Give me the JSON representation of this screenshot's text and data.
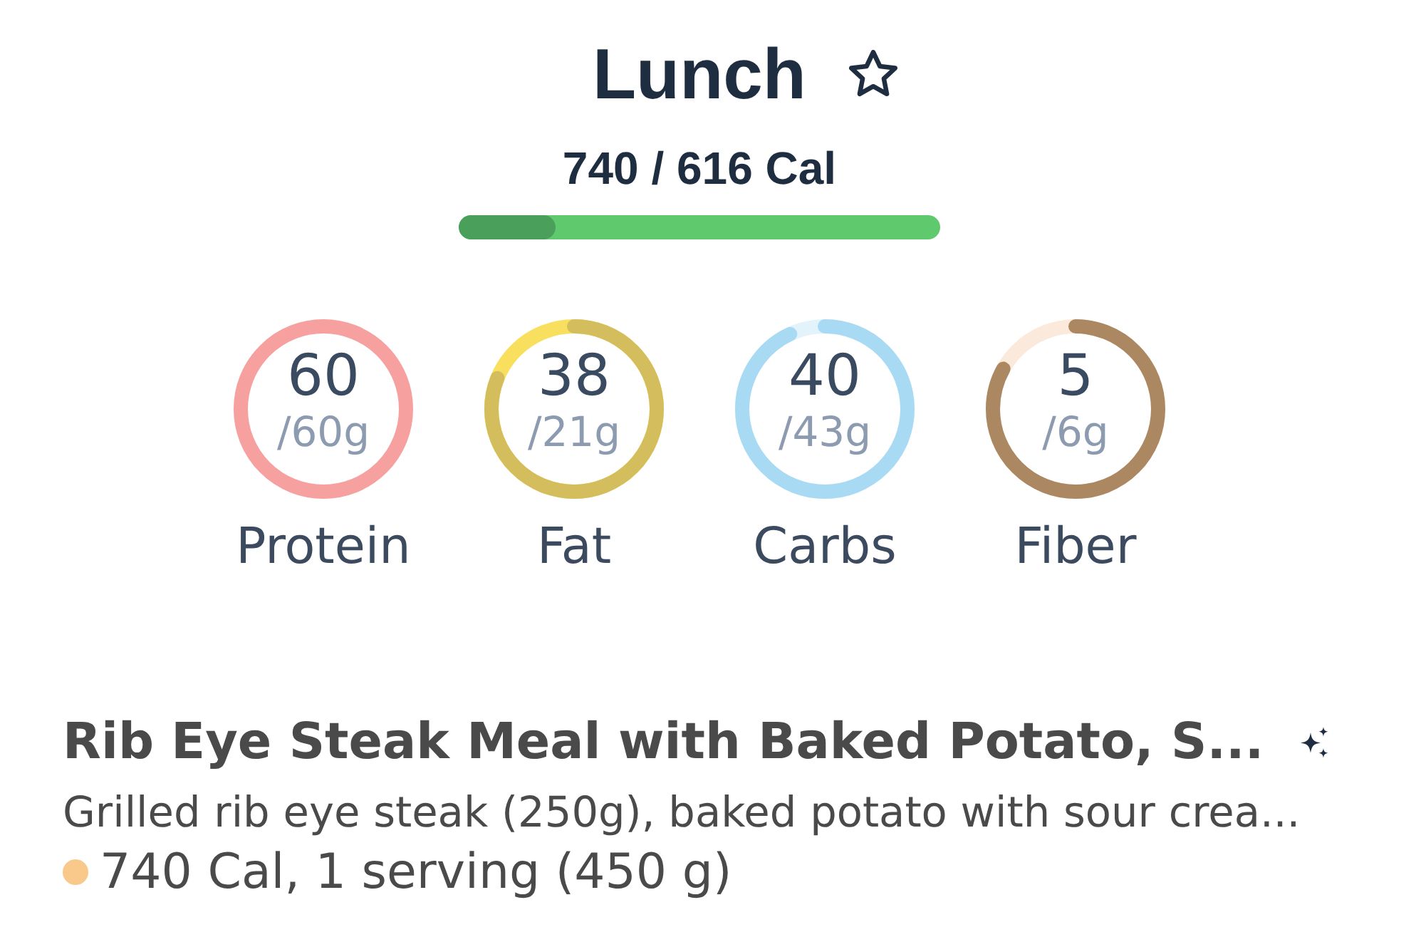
{
  "meal": {
    "title": "Lunch",
    "favorite": false,
    "calories": "740 / 616 Cal",
    "calorie_bar": {
      "level": 0.2
    }
  },
  "macros": [
    {
      "value": "60",
      "goal": "/60g",
      "label": "Protein",
      "level": 1,
      "color": "#f6a09f"
    },
    {
      "value": "38",
      "goal": "/21g",
      "label": "Fat",
      "level": 0.81,
      "color": "#d3bd5d",
      "track": {
        "color": "#f8e05e"
      }
    },
    {
      "value": "40",
      "goal": "/43g",
      "label": "Carbs",
      "level": 0.93,
      "color": "#a9daf3",
      "track": {
        "color": "#e3f3fc"
      }
    },
    {
      "value": "5",
      "goal": "/6g",
      "label": "Fiber",
      "level": 0.83,
      "color": "#ab8862",
      "track": {
        "color": "#fbeadb"
      }
    }
  ],
  "foods": [
    {
      "name": "Rib Eye Steak Meal with Baked Potato, S...",
      "description": "Grilled rib eye steak (250g), baked potato with sour crea...",
      "calories": "740 Cal, 1 serving (450 g)",
      "color": "#f9c98b"
    }
  ]
}
